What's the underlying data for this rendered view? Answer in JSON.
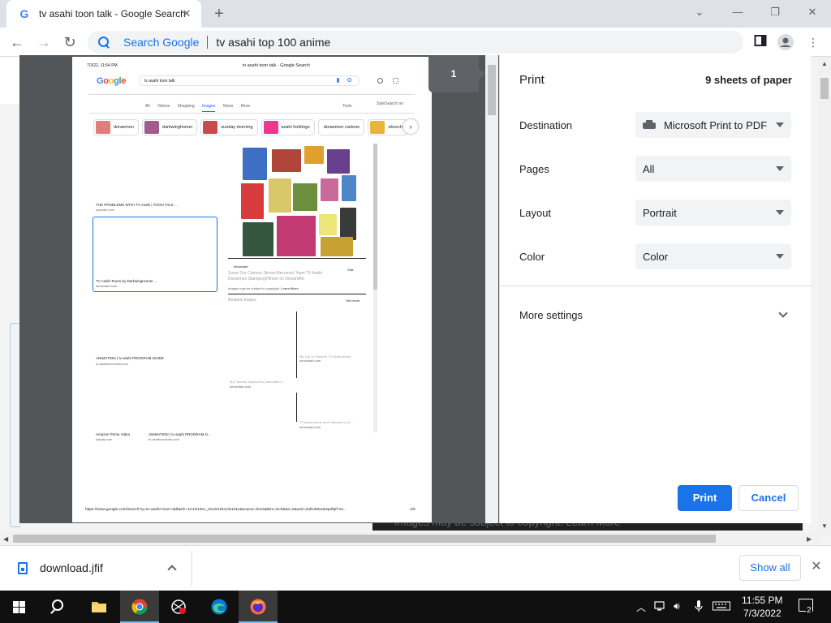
{
  "browser": {
    "tab_title": "tv asahi toon talk - Google Search",
    "tab_favicon": "G",
    "new_tab": "+",
    "window": {
      "minimize": "⌄",
      "maximize": "—",
      "restore": "❐",
      "close": "✕"
    },
    "omnibox": {
      "engine": "Search Google",
      "query": "tv asahi top 100 anime"
    }
  },
  "background_page": {
    "footer_text": "Images may be subject to copyright. Learn More"
  },
  "preview": {
    "page_badge": "1",
    "header_date": "7/3/22, 11:54 PM",
    "header_title": "tv asahi toon talk - Google Search",
    "search_query": "tv asahi toon talk",
    "tabs": [
      "All",
      "Videos",
      "Shopping",
      "Images",
      "News",
      "More"
    ],
    "tools": "Tools",
    "safesearch": "SafeSearch on",
    "chips": [
      {
        "label": "doraemon",
        "color": "#e27d7d"
      },
      {
        "label": "darkwinghomer",
        "color": "#a05c8c"
      },
      {
        "label": "sunday morning",
        "color": "#c84b4b"
      },
      {
        "label": "asahi holdings",
        "color": "#e83a8e"
      },
      {
        "label": "doraemon cartoon",
        "color": "#ffffff"
      },
      {
        "label": "obocch",
        "color": "#e8b53a"
      }
    ],
    "results": [
      {
        "title": "THE PROBLEMS WITH TV Asahi | TOON TALK ...",
        "source": "youtube.com"
      },
      {
        "title": "TV Asahi Toons by DarkwingHomer ...",
        "source": "deviantart.com"
      },
      {
        "title": "ANIMATION | tv asahi PROGRAM GUIDE",
        "source": "tv-asahiscontents.com"
      },
      {
        "title": "Amazon Prime Video",
        "source": "adopty.com"
      },
      {
        "title": "ANIMATION | tv asahi PROGRAM G...",
        "source": "tv-asahicontents.com"
      }
    ],
    "detail": {
      "source": "deviantart",
      "visit": "Visit",
      "title_line1": "Some Our Cartoon Steven Becomes Team TV Asahi",
      "title_line2": "Doraemon Stamping/Hirone on DeviantArt",
      "copyright": "Images may be subject to copyright.",
      "learn_more": "Learn More",
      "related": "Related images",
      "see_more": "See more",
      "rel1_title": "My Top 10 Favorite TV Asahi shows",
      "rel1_src": "deviantart.com",
      "rel2_title": "My Favorite (dis)m(ores) Animated S...",
      "rel2_src": "deviantart.com",
      "rel3_title": "TV Asahi anime and Cartoons by D...",
      "rel3_src": "deviantart.com"
    },
    "footer_url": "https://www.google.com/search?q=tv+asahi+toon+talk&rlz=1C1GCEA_enUS1011US1011&source=lnms&tbm=isch&sa=X&ved=2ahUKEwis2p3fqf74A...",
    "footer_page": "1/9"
  },
  "print": {
    "title": "Print",
    "sheets": "9 sheets of paper",
    "destination_label": "Destination",
    "destination_value": "Microsoft Print to PDF",
    "pages_label": "Pages",
    "pages_value": "All",
    "layout_label": "Layout",
    "layout_value": "Portrait",
    "color_label": "Color",
    "color_value": "Color",
    "more_settings": "More settings",
    "print_button": "Print",
    "cancel_button": "Cancel"
  },
  "downloads": {
    "file_name": "download.jfif",
    "show_all": "Show all",
    "close": "✕"
  },
  "taskbar": {
    "time": "11:55 PM",
    "date": "7/3/2022",
    "notifications": "2"
  },
  "colors": {
    "accent": "#1a73e8",
    "preview_bg": "#525659",
    "taskbar": "#101010"
  }
}
